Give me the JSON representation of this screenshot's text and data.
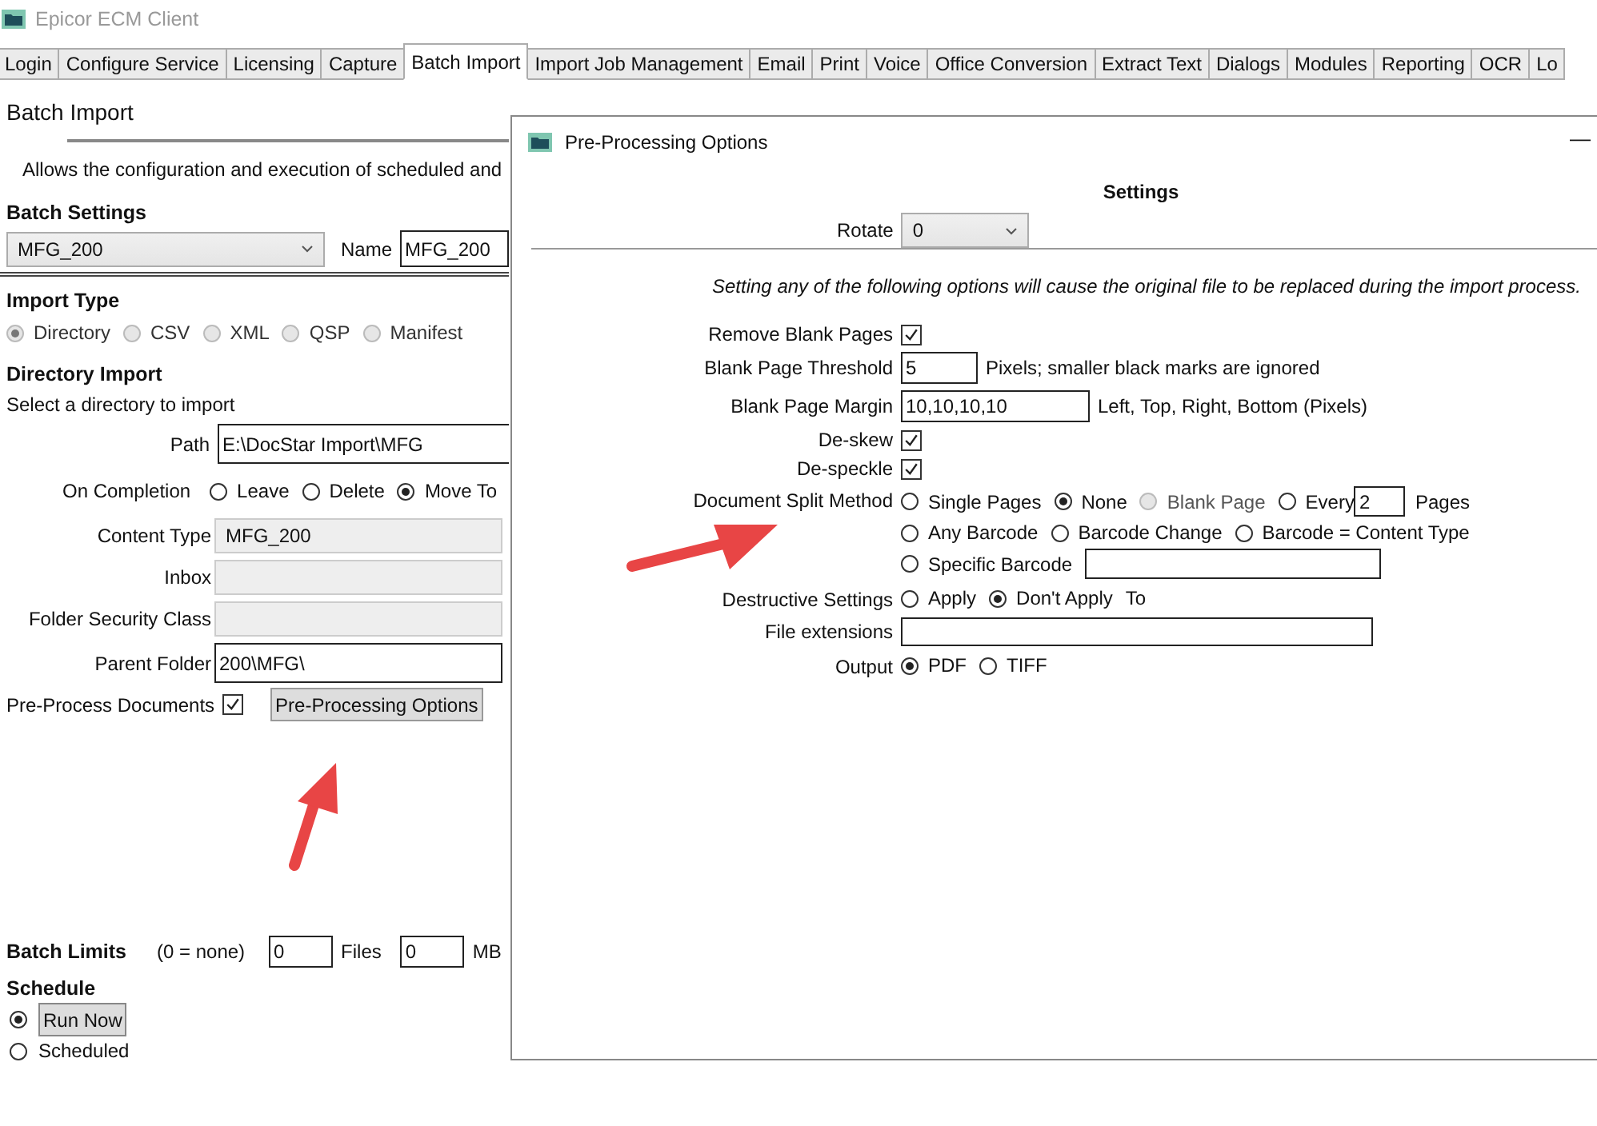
{
  "window": {
    "title": "Epicor ECM Client"
  },
  "tabs": [
    {
      "label": "Login",
      "selected": false
    },
    {
      "label": "Configure Service",
      "selected": false
    },
    {
      "label": "Licensing",
      "selected": false
    },
    {
      "label": "Capture",
      "selected": false
    },
    {
      "label": "Batch Import",
      "selected": true
    },
    {
      "label": "Import Job Management",
      "selected": false
    },
    {
      "label": "Email",
      "selected": false
    },
    {
      "label": "Print",
      "selected": false
    },
    {
      "label": "Voice",
      "selected": false
    },
    {
      "label": "Office Conversion",
      "selected": false
    },
    {
      "label": "Extract Text",
      "selected": false
    },
    {
      "label": "Dialogs",
      "selected": false
    },
    {
      "label": "Modules",
      "selected": false
    },
    {
      "label": "Reporting",
      "selected": false
    },
    {
      "label": "OCR",
      "selected": false
    },
    {
      "label": "Lo",
      "selected": false
    }
  ],
  "page": {
    "heading": "Batch Import",
    "description": "Allows the configuration and execution of scheduled and"
  },
  "batch_settings": {
    "heading": "Batch Settings",
    "batch": "MFG_200",
    "name_label": "Name",
    "name_value": "MFG_200"
  },
  "import_type": {
    "heading": "Import Type",
    "options": [
      {
        "label": "Directory",
        "selected": true,
        "disabled": true
      },
      {
        "label": "CSV",
        "selected": false,
        "disabled": true
      },
      {
        "label": "XML",
        "selected": false,
        "disabled": true
      },
      {
        "label": "QSP",
        "selected": false,
        "disabled": true
      },
      {
        "label": "Manifest",
        "selected": false,
        "disabled": true
      }
    ]
  },
  "directory_import": {
    "heading": "Directory Import",
    "hint": "Select a directory to import",
    "path_label": "Path",
    "path_value": "E:\\DocStar Import\\MFG",
    "completion_label": "On Completion",
    "completion_options": [
      {
        "label": "Leave",
        "selected": false
      },
      {
        "label": "Delete",
        "selected": false
      },
      {
        "label": "Move To",
        "selected": true
      }
    ],
    "combos": [
      {
        "label": "Content Type",
        "value": "MFG_200"
      },
      {
        "label": "Inbox"
      },
      {
        "label": "Folder Security Class"
      }
    ],
    "parent_folder_label": "Parent Folder",
    "parent_folder_value": "200\\MFG\\",
    "preprocess_label": "Pre-Process Documents",
    "preprocess_checked": true,
    "preprocess_button": "Pre-Processing Options"
  },
  "batch_limits": {
    "heading": "Batch Limits",
    "hint": "(0 = none)",
    "files_value": "0",
    "files_label": "Files",
    "mb_value": "0",
    "mb_label": "MB"
  },
  "schedule": {
    "heading": "Schedule",
    "options": [
      {
        "label": "Run Now",
        "selected": true,
        "kind": "button"
      },
      {
        "label": "Scheduled",
        "selected": false,
        "kind": "text"
      }
    ]
  },
  "dialog": {
    "title": "Pre-Processing Options",
    "minimize": "—",
    "heading": "Settings",
    "rotate_label": "Rotate",
    "rotate_value": "0",
    "note": "Setting any of the following options will cause the original file to be replaced during the import process.",
    "rows": [
      {
        "kind": "check",
        "label": "Remove Blank Pages",
        "checked": true
      },
      {
        "kind": "number",
        "label": "Blank Page Threshold",
        "value": "5",
        "suffix": "Pixels; smaller black marks are ignored"
      },
      {
        "kind": "text",
        "label": "Blank Page Margin",
        "value": "10,10,10,10",
        "suffix": "Left, Top, Right, Bottom (Pixels)"
      },
      {
        "kind": "check",
        "label": "De-skew",
        "checked": true
      },
      {
        "kind": "check",
        "label": "De-speckle",
        "checked": true
      },
      {
        "kind": "radios",
        "label": "Document Split Method",
        "lines": [
          [
            {
              "kind": "plain",
              "label": "Single Pages",
              "selected": false,
              "disabled": false
            },
            {
              "kind": "plain",
              "label": "None",
              "selected": true,
              "disabled": false
            },
            {
              "kind": "plain",
              "label": "Blank Page",
              "selected": false,
              "disabled": true
            },
            {
              "kind": "count",
              "label": "Every",
              "value": "2",
              "suffix": "Pages",
              "selected": false,
              "disabled": false
            }
          ],
          [
            {
              "kind": "plain",
              "label": "Any Barcode",
              "selected": false,
              "disabled": false
            },
            {
              "kind": "plain",
              "label": "Barcode Change",
              "selected": false,
              "disabled": false
            },
            {
              "kind": "plain",
              "label": "Barcode = Content Type",
              "selected": false,
              "disabled": false
            }
          ],
          [
            {
              "kind": "field",
              "label": "Specific Barcode",
              "selected": false,
              "disabled": false
            }
          ]
        ]
      },
      {
        "kind": "radios",
        "label": "Destructive Settings",
        "suffix": "To",
        "lines": [
          [
            {
              "kind": "plain",
              "label": "Apply",
              "selected": false,
              "disabled": false
            },
            {
              "kind": "plain",
              "label": "Don't Apply",
              "selected": true,
              "disabled": false
            }
          ]
        ]
      },
      {
        "kind": "wide_text",
        "label": "File extensions"
      },
      {
        "kind": "radios",
        "label": "Output",
        "lines": [
          [
            {
              "kind": "plain",
              "label": "PDF",
              "selected": true,
              "disabled": false
            },
            {
              "kind": "plain",
              "label": "TIFF",
              "selected": false,
              "disabled": false
            }
          ]
        ]
      }
    ]
  }
}
